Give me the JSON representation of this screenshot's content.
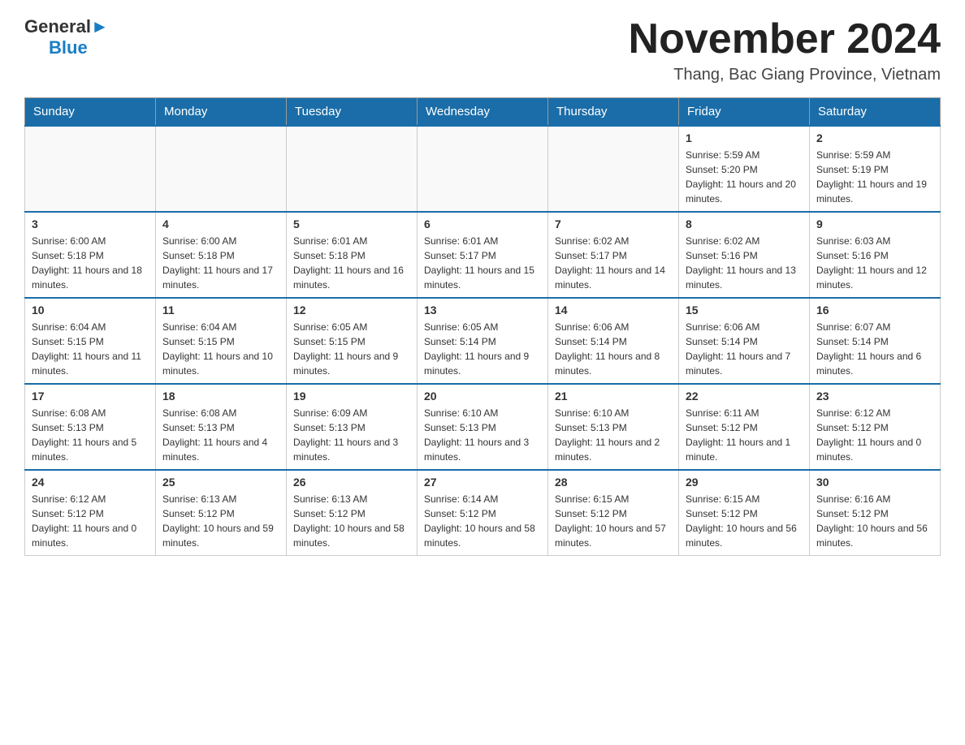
{
  "logo": {
    "general": "General",
    "arrow": "",
    "blue": "Blue"
  },
  "title": "November 2024",
  "location": "Thang, Bac Giang Province, Vietnam",
  "days_of_week": [
    "Sunday",
    "Monday",
    "Tuesday",
    "Wednesday",
    "Thursday",
    "Friday",
    "Saturday"
  ],
  "weeks": [
    [
      {
        "day": "",
        "info": ""
      },
      {
        "day": "",
        "info": ""
      },
      {
        "day": "",
        "info": ""
      },
      {
        "day": "",
        "info": ""
      },
      {
        "day": "",
        "info": ""
      },
      {
        "day": "1",
        "info": "Sunrise: 5:59 AM\nSunset: 5:20 PM\nDaylight: 11 hours and 20 minutes."
      },
      {
        "day": "2",
        "info": "Sunrise: 5:59 AM\nSunset: 5:19 PM\nDaylight: 11 hours and 19 minutes."
      }
    ],
    [
      {
        "day": "3",
        "info": "Sunrise: 6:00 AM\nSunset: 5:18 PM\nDaylight: 11 hours and 18 minutes."
      },
      {
        "day": "4",
        "info": "Sunrise: 6:00 AM\nSunset: 5:18 PM\nDaylight: 11 hours and 17 minutes."
      },
      {
        "day": "5",
        "info": "Sunrise: 6:01 AM\nSunset: 5:18 PM\nDaylight: 11 hours and 16 minutes."
      },
      {
        "day": "6",
        "info": "Sunrise: 6:01 AM\nSunset: 5:17 PM\nDaylight: 11 hours and 15 minutes."
      },
      {
        "day": "7",
        "info": "Sunrise: 6:02 AM\nSunset: 5:17 PM\nDaylight: 11 hours and 14 minutes."
      },
      {
        "day": "8",
        "info": "Sunrise: 6:02 AM\nSunset: 5:16 PM\nDaylight: 11 hours and 13 minutes."
      },
      {
        "day": "9",
        "info": "Sunrise: 6:03 AM\nSunset: 5:16 PM\nDaylight: 11 hours and 12 minutes."
      }
    ],
    [
      {
        "day": "10",
        "info": "Sunrise: 6:04 AM\nSunset: 5:15 PM\nDaylight: 11 hours and 11 minutes."
      },
      {
        "day": "11",
        "info": "Sunrise: 6:04 AM\nSunset: 5:15 PM\nDaylight: 11 hours and 10 minutes."
      },
      {
        "day": "12",
        "info": "Sunrise: 6:05 AM\nSunset: 5:15 PM\nDaylight: 11 hours and 9 minutes."
      },
      {
        "day": "13",
        "info": "Sunrise: 6:05 AM\nSunset: 5:14 PM\nDaylight: 11 hours and 9 minutes."
      },
      {
        "day": "14",
        "info": "Sunrise: 6:06 AM\nSunset: 5:14 PM\nDaylight: 11 hours and 8 minutes."
      },
      {
        "day": "15",
        "info": "Sunrise: 6:06 AM\nSunset: 5:14 PM\nDaylight: 11 hours and 7 minutes."
      },
      {
        "day": "16",
        "info": "Sunrise: 6:07 AM\nSunset: 5:14 PM\nDaylight: 11 hours and 6 minutes."
      }
    ],
    [
      {
        "day": "17",
        "info": "Sunrise: 6:08 AM\nSunset: 5:13 PM\nDaylight: 11 hours and 5 minutes."
      },
      {
        "day": "18",
        "info": "Sunrise: 6:08 AM\nSunset: 5:13 PM\nDaylight: 11 hours and 4 minutes."
      },
      {
        "day": "19",
        "info": "Sunrise: 6:09 AM\nSunset: 5:13 PM\nDaylight: 11 hours and 3 minutes."
      },
      {
        "day": "20",
        "info": "Sunrise: 6:10 AM\nSunset: 5:13 PM\nDaylight: 11 hours and 3 minutes."
      },
      {
        "day": "21",
        "info": "Sunrise: 6:10 AM\nSunset: 5:13 PM\nDaylight: 11 hours and 2 minutes."
      },
      {
        "day": "22",
        "info": "Sunrise: 6:11 AM\nSunset: 5:12 PM\nDaylight: 11 hours and 1 minute."
      },
      {
        "day": "23",
        "info": "Sunrise: 6:12 AM\nSunset: 5:12 PM\nDaylight: 11 hours and 0 minutes."
      }
    ],
    [
      {
        "day": "24",
        "info": "Sunrise: 6:12 AM\nSunset: 5:12 PM\nDaylight: 11 hours and 0 minutes."
      },
      {
        "day": "25",
        "info": "Sunrise: 6:13 AM\nSunset: 5:12 PM\nDaylight: 10 hours and 59 minutes."
      },
      {
        "day": "26",
        "info": "Sunrise: 6:13 AM\nSunset: 5:12 PM\nDaylight: 10 hours and 58 minutes."
      },
      {
        "day": "27",
        "info": "Sunrise: 6:14 AM\nSunset: 5:12 PM\nDaylight: 10 hours and 58 minutes."
      },
      {
        "day": "28",
        "info": "Sunrise: 6:15 AM\nSunset: 5:12 PM\nDaylight: 10 hours and 57 minutes."
      },
      {
        "day": "29",
        "info": "Sunrise: 6:15 AM\nSunset: 5:12 PM\nDaylight: 10 hours and 56 minutes."
      },
      {
        "day": "30",
        "info": "Sunrise: 6:16 AM\nSunset: 5:12 PM\nDaylight: 10 hours and 56 minutes."
      }
    ]
  ]
}
